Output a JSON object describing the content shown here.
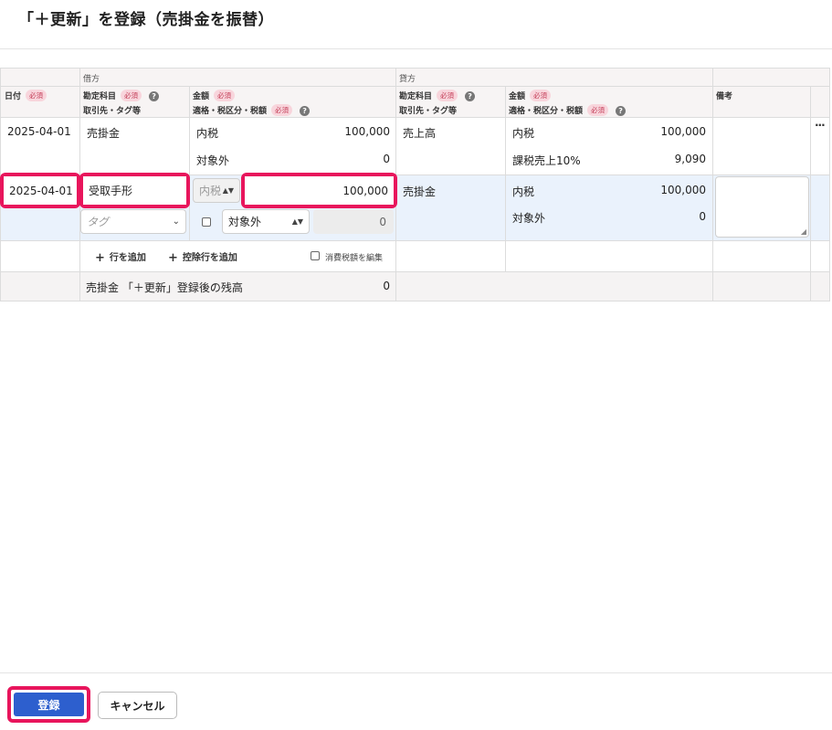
{
  "page": {
    "title": "「＋更新」を登録（売掛金を振替）"
  },
  "header": {
    "debit_section": "借方",
    "credit_section": "貸方",
    "date": "日付",
    "required": "必須",
    "debit_account": "勘定科目",
    "debit_partner": "取引先・タグ等",
    "debit_amount": "金額",
    "debit_tax": "適格・税区分・税額",
    "credit_account": "勘定科目",
    "credit_partner": "取引先・タグ等",
    "credit_amount": "金額",
    "credit_tax": "適格・税区分・税額",
    "memo": "備考",
    "help": "?"
  },
  "row1": {
    "date": "2025-04-01",
    "debit_account": "売掛金",
    "debit_tax_type": "内税",
    "debit_amount": "100,000",
    "debit_tax_category": "対象外",
    "debit_tax_amount": "0",
    "credit_account": "売上高",
    "credit_tax_type": "内税",
    "credit_amount": "100,000",
    "credit_tax_category": "課税売上10%",
    "credit_tax_amount": "9,090",
    "more": "···"
  },
  "row2": {
    "date": "2025-04-01",
    "debit_account": "受取手形",
    "tag_placeholder": "タグ",
    "tax_type_select": "内税",
    "amount": "100,000",
    "tax_category_select": "対象外",
    "tax_amount": "0",
    "credit_account": "売掛金",
    "credit_tax_type": "内税",
    "credit_amount": "100,000",
    "credit_tax_category": "対象外",
    "credit_tax_amount": "0"
  },
  "actions": {
    "add_row": "行を追加",
    "add_deduction_row": "控除行を追加",
    "edit_tax": "消費税額を編集"
  },
  "total": {
    "label": "売掛金 「＋更新」登録後の残高",
    "value": "0"
  },
  "footer": {
    "submit": "登録",
    "cancel": "キャンセル"
  },
  "colors": {
    "primary": "#2d5fce",
    "highlight": "#e8155c",
    "row_highlight": "#eaf2fc"
  }
}
